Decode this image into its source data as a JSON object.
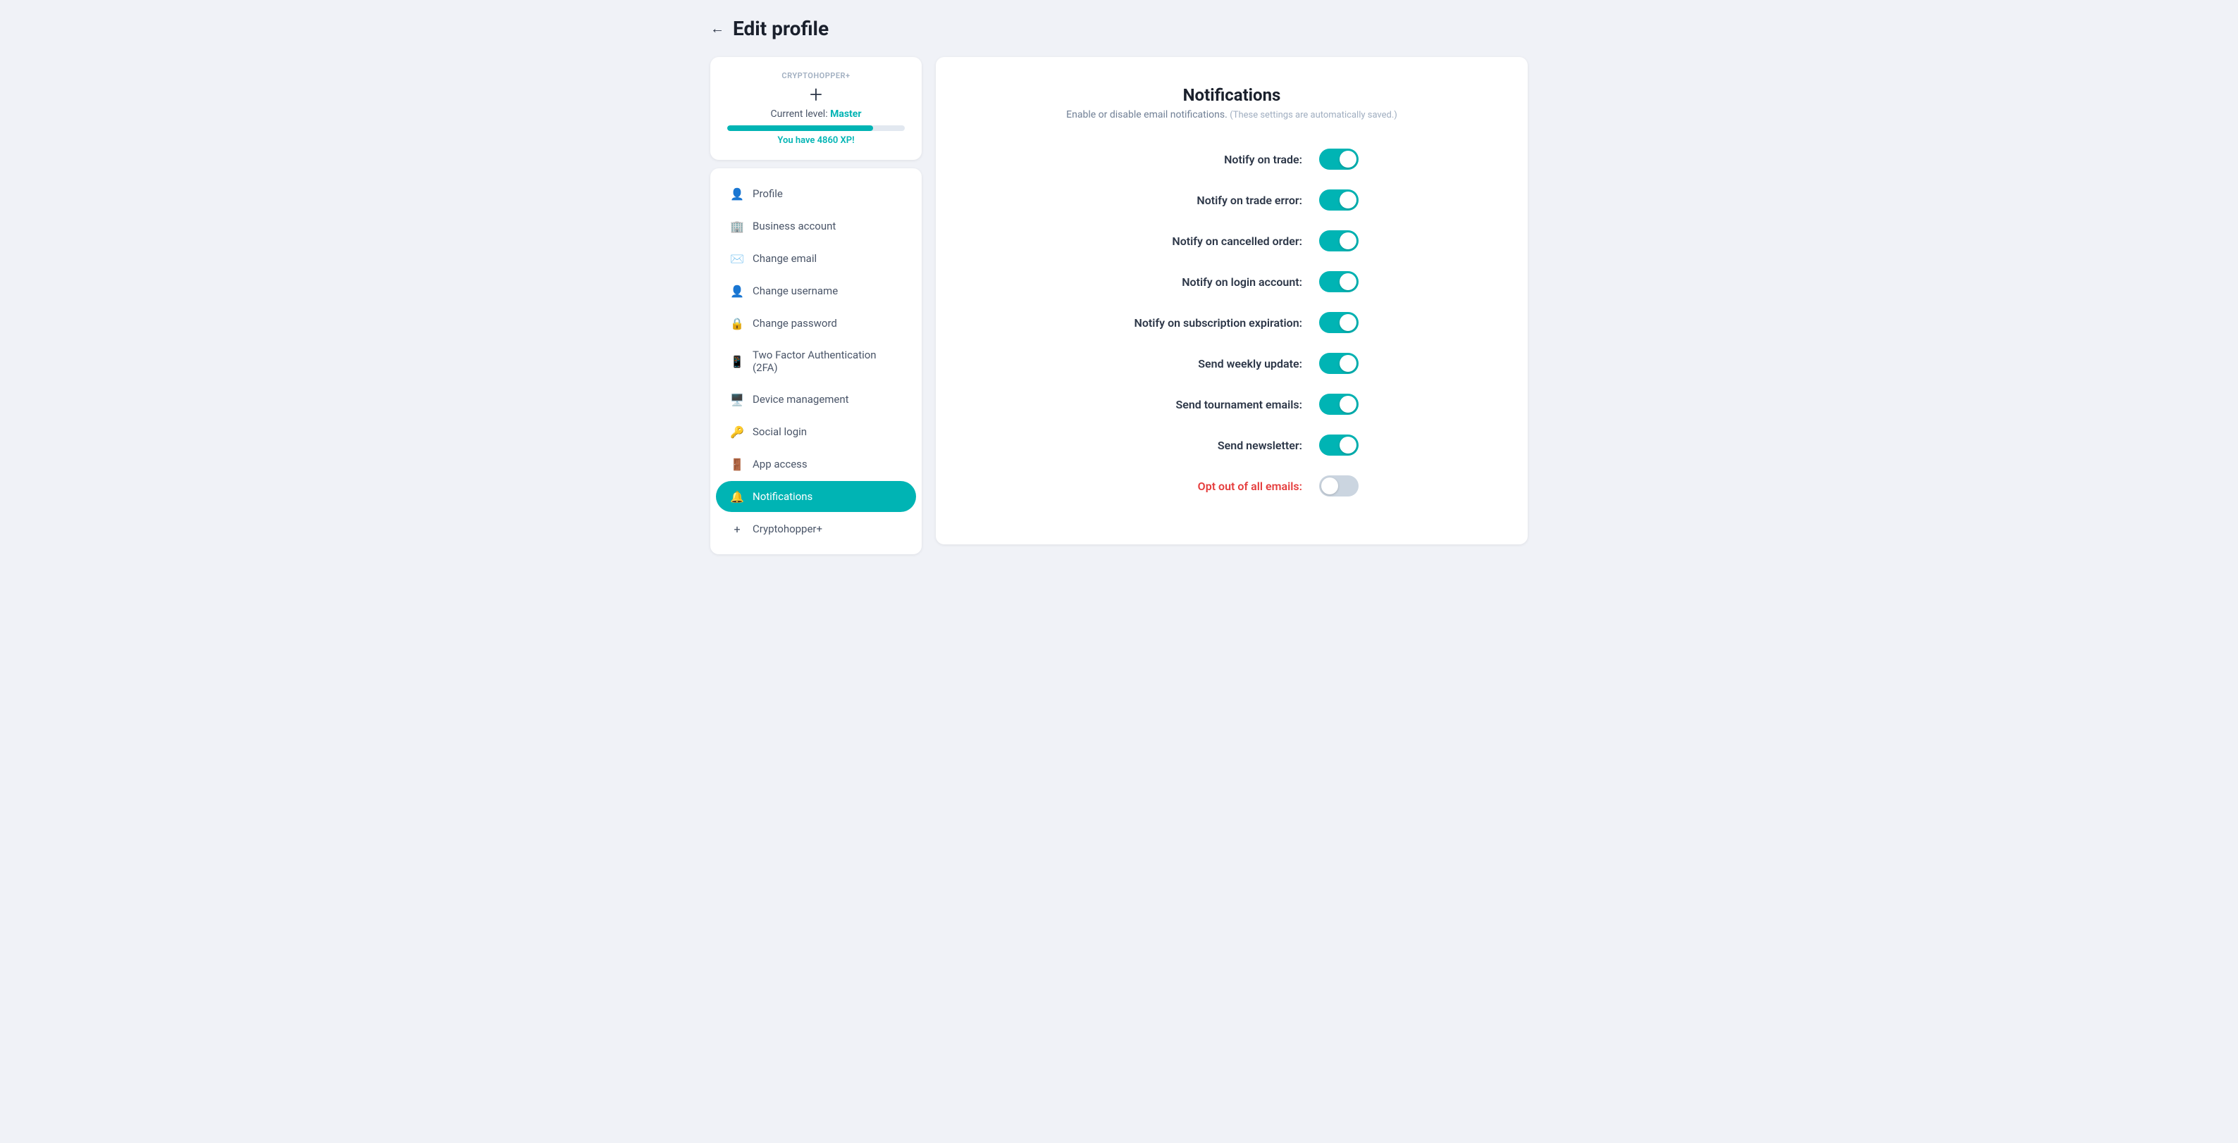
{
  "header": {
    "back_label": "←",
    "title": "Edit profile"
  },
  "xp_card": {
    "badge_label": "CRYPTOHOPPER+",
    "plus_icon": "+",
    "level_prefix": "Current level:",
    "level_value": "Master",
    "xp_bar_percent": 82,
    "xp_amount": "You have 4860 XP!"
  },
  "nav": {
    "items": [
      {
        "id": "profile",
        "label": "Profile",
        "icon": "👤"
      },
      {
        "id": "business-account",
        "label": "Business account",
        "icon": "🏢"
      },
      {
        "id": "change-email",
        "label": "Change email",
        "icon": "✉️"
      },
      {
        "id": "change-username",
        "label": "Change username",
        "icon": "👤"
      },
      {
        "id": "change-password",
        "label": "Change password",
        "icon": "🔒"
      },
      {
        "id": "two-factor",
        "label": "Two Factor Authentication (2FA)",
        "icon": "📱"
      },
      {
        "id": "device-management",
        "label": "Device management",
        "icon": "🖥️"
      },
      {
        "id": "social-login",
        "label": "Social login",
        "icon": "🔑"
      },
      {
        "id": "app-access",
        "label": "App access",
        "icon": "🚪"
      },
      {
        "id": "notifications",
        "label": "Notifications",
        "icon": "🔔",
        "active": true
      },
      {
        "id": "cryptohopper-plus",
        "label": "Cryptohopper+",
        "icon": "+"
      }
    ]
  },
  "content": {
    "title": "Notifications",
    "subtitle": "Enable or disable email notifications.",
    "auto_save_note": "(These settings are automatically saved.)",
    "toggles": [
      {
        "id": "notify-trade",
        "label": "Notify on trade:",
        "checked": true,
        "opt_out": false
      },
      {
        "id": "notify-trade-error",
        "label": "Notify on trade error:",
        "checked": true,
        "opt_out": false
      },
      {
        "id": "notify-cancelled-order",
        "label": "Notify on cancelled order:",
        "checked": true,
        "opt_out": false
      },
      {
        "id": "notify-login-account",
        "label": "Notify on login account:",
        "checked": true,
        "opt_out": false
      },
      {
        "id": "notify-subscription-expiration",
        "label": "Notify on subscription expiration:",
        "checked": true,
        "opt_out": false
      },
      {
        "id": "send-weekly-update",
        "label": "Send weekly update:",
        "checked": true,
        "opt_out": false
      },
      {
        "id": "send-tournament-emails",
        "label": "Send tournament emails:",
        "checked": true,
        "opt_out": false
      },
      {
        "id": "send-newsletter",
        "label": "Send newsletter:",
        "checked": true,
        "opt_out": false
      },
      {
        "id": "opt-out-all-emails",
        "label": "Opt out of all emails:",
        "checked": false,
        "opt_out": true
      }
    ]
  }
}
